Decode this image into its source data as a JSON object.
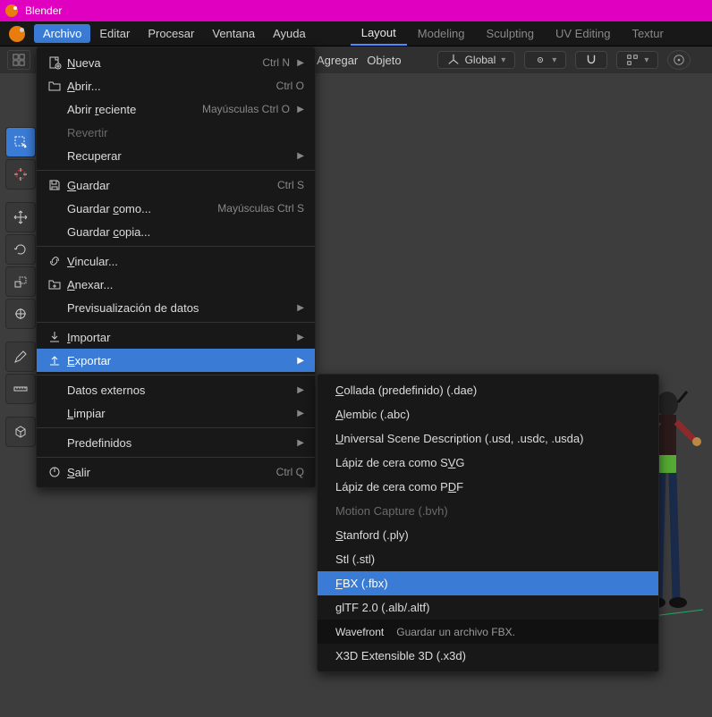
{
  "window": {
    "title": "Blender"
  },
  "menubar": {
    "items": [
      "Archivo",
      "Editar",
      "Procesar",
      "Ventana",
      "Ayuda"
    ],
    "active_index": 0
  },
  "workspace_tabs": {
    "items": [
      "Layout",
      "Modeling",
      "Sculpting",
      "UV Editing",
      "Textur"
    ],
    "active_index": 0
  },
  "header": {
    "add": "Agregar",
    "object": "Objeto",
    "orientation": "Global"
  },
  "file_menu": {
    "items": [
      {
        "icon": "new-icon",
        "label": "Nueva",
        "u": 0,
        "shortcut": "Ctrl N",
        "arrow": true
      },
      {
        "icon": "open-icon",
        "label": "Abrir...",
        "u": 0,
        "shortcut": "Ctrl O"
      },
      {
        "icon": "",
        "label": "Abrir reciente",
        "u": 6,
        "shortcut": "Mayúsculas Ctrl O",
        "arrow": true
      },
      {
        "icon": "",
        "label": "Revertir",
        "disabled": true
      },
      {
        "icon": "",
        "label": "Recuperar",
        "arrow": true
      },
      {
        "sep": true
      },
      {
        "icon": "save-icon",
        "label": "Guardar",
        "u": 0,
        "shortcut": "Ctrl S"
      },
      {
        "icon": "",
        "label": "Guardar como...",
        "u": 8,
        "shortcut": "Mayúsculas Ctrl S"
      },
      {
        "icon": "",
        "label": "Guardar copia...",
        "u": 8
      },
      {
        "sep": true
      },
      {
        "icon": "link-icon",
        "label": "Vincular...",
        "u": 0
      },
      {
        "icon": "append-icon",
        "label": "Anexar...",
        "u": 0
      },
      {
        "icon": "",
        "label": "Previsualización de datos",
        "arrow": true
      },
      {
        "sep": true
      },
      {
        "icon": "import-icon",
        "label": "Importar",
        "u": 0,
        "arrow": true
      },
      {
        "icon": "export-icon",
        "label": "Exportar",
        "u": 0,
        "arrow": true,
        "highlight": true
      },
      {
        "sep": true
      },
      {
        "icon": "",
        "label": "Datos externos",
        "arrow": true
      },
      {
        "icon": "",
        "label": "Limpiar",
        "u": 0,
        "arrow": true
      },
      {
        "sep": true
      },
      {
        "icon": "",
        "label": "Predefinidos",
        "arrow": true
      },
      {
        "sep": true
      },
      {
        "icon": "quit-icon",
        "label": "Salir",
        "u": 0,
        "shortcut": "Ctrl Q"
      }
    ]
  },
  "export_submenu": {
    "items": [
      {
        "label": "Collada (predefinido) (.dae)",
        "u": 0
      },
      {
        "label": "Alembic (.abc)",
        "u": 0
      },
      {
        "label": "Universal Scene Description (.usd, .usdc, .usda)",
        "u": 0
      },
      {
        "label": "Lápiz de cera como SVG",
        "u": 20
      },
      {
        "label": "Lápiz de cera como PDF",
        "u": 20
      },
      {
        "label": "Motion Capture (.bvh)",
        "disabled": true
      },
      {
        "label": "Stanford (.ply)",
        "u": 0
      },
      {
        "label": "Stl (.stl)"
      },
      {
        "label": "FBX (.fbx)",
        "u": 0,
        "highlight": true
      },
      {
        "label": "glTF 2.0 (.alb/.altf)"
      },
      {
        "label_a": "Wavefront",
        "label_b": "Guardar un archivo FBX.",
        "tooltip": true
      },
      {
        "label": "X3D Extensible 3D (.x3d)"
      }
    ]
  }
}
